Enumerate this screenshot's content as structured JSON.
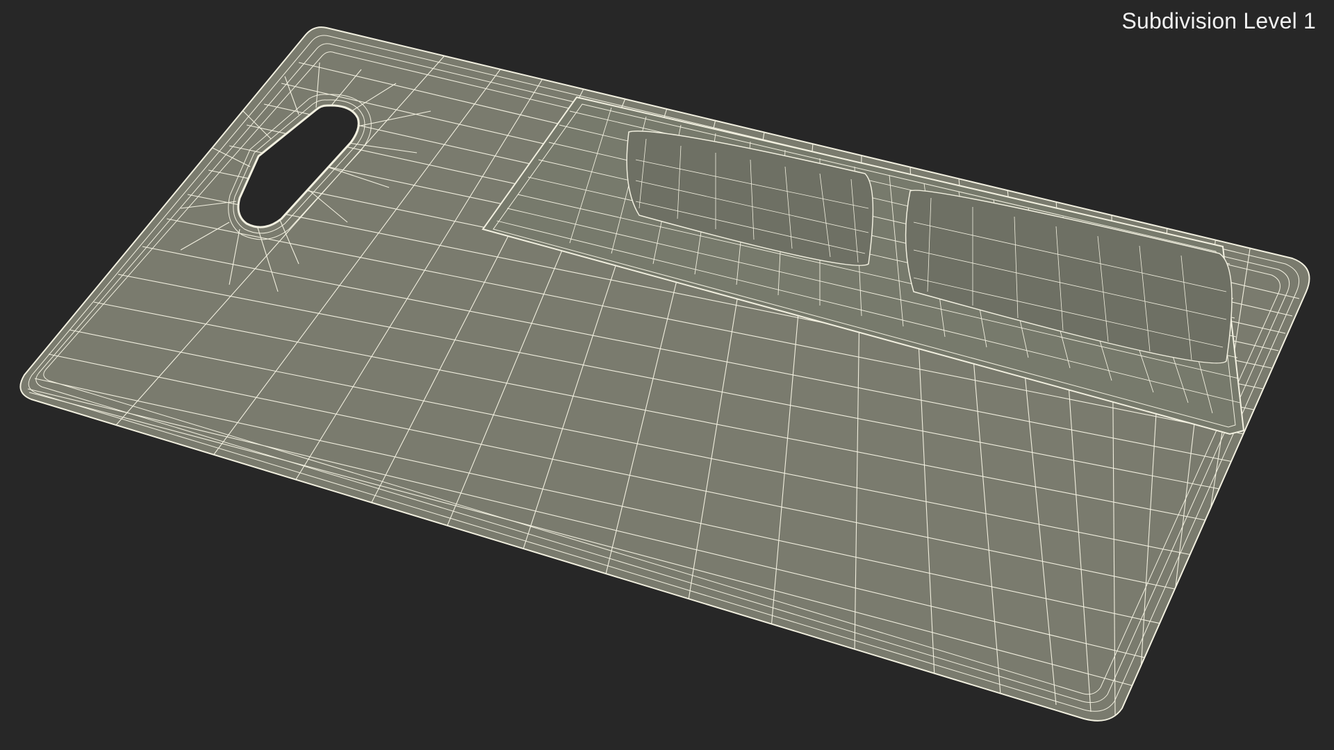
{
  "viewport": {
    "subdivision_label": "Subdivision Level 1",
    "background_color": "#272727"
  },
  "model": {
    "subject": "cutting-board-wireframe",
    "surface_color": "#7a7b6e",
    "wire_color": "#f2f0e0",
    "shadow_color": "#6c6d62"
  }
}
